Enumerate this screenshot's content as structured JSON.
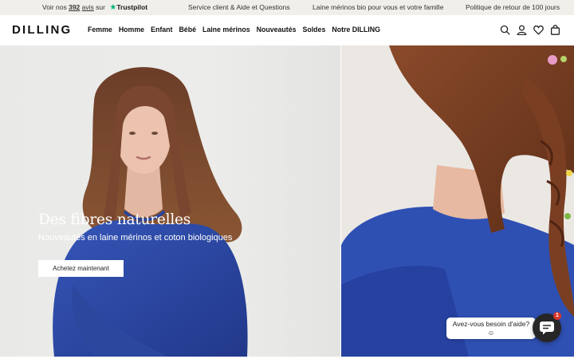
{
  "announcement": {
    "reviews_prefix": "Voir nos",
    "reviews_count": "392",
    "reviews_word": "avis",
    "reviews_suffix": "sur",
    "trustpilot": "Trustpilot",
    "service": "Service client & Aide et Questions",
    "merino": "Laine mérinos bio pour vous et votre famille",
    "returns": "Politique de retour de 100 jours"
  },
  "header": {
    "logo": "DILLING",
    "nav": [
      "Femme",
      "Homme",
      "Enfant",
      "Bébé",
      "Laine mérinos",
      "Nouveautés",
      "Soldes",
      "Notre DILLING"
    ],
    "icons": [
      "search-icon",
      "account-icon",
      "wishlist-icon",
      "cart-icon"
    ]
  },
  "hero": {
    "title": "Des fibres naturelles",
    "subtitle": "Nouveautés en laine mérinos et coton biologiques",
    "cta": "Achetez maintenant"
  },
  "chat": {
    "prompt": "Avez-vous besoin d'aide?",
    "emoji": "☺",
    "badge": "1"
  },
  "colors": {
    "topbar_bg": "#f1efea",
    "trustpilot_green": "#00b67a",
    "sweater_blue": "#2f4fae",
    "chat_dark": "#262626",
    "badge_red": "#d9362b"
  }
}
